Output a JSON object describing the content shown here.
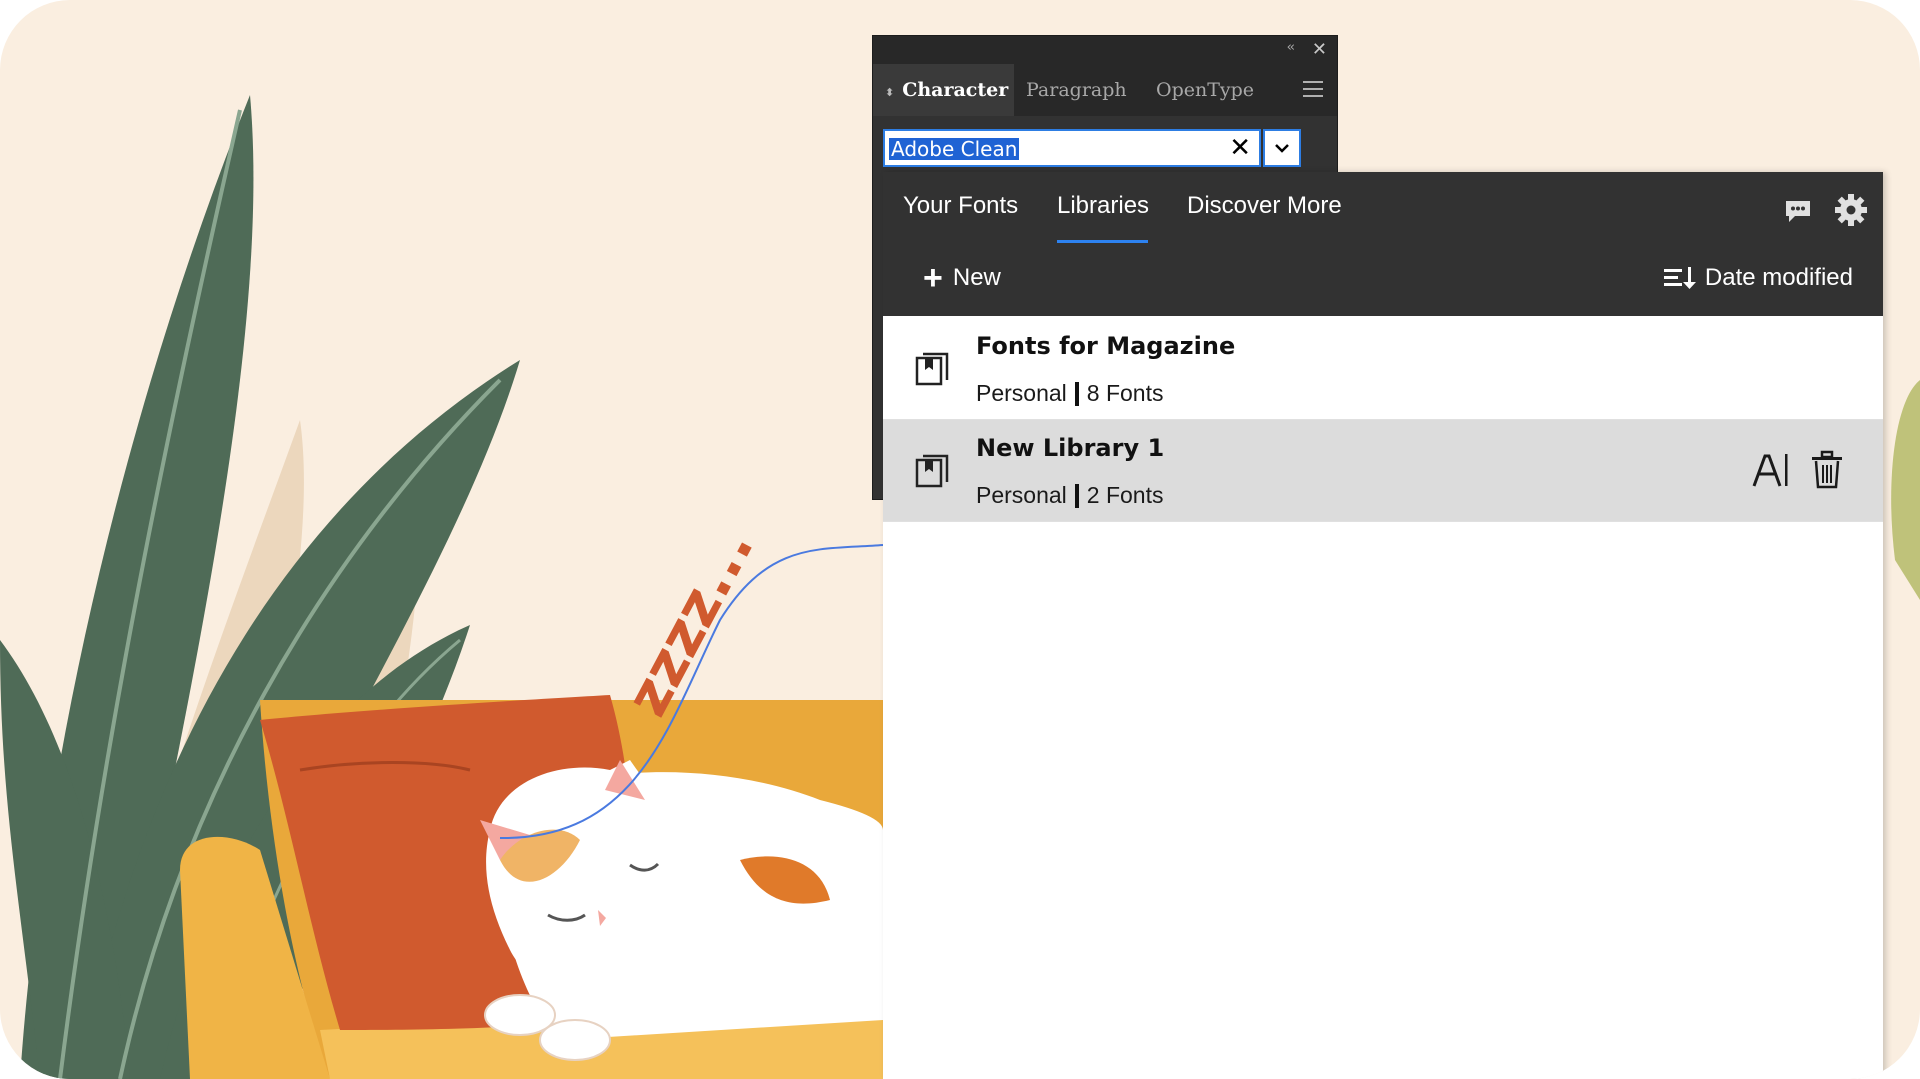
{
  "character_panel": {
    "tabs": [
      {
        "label": "Character",
        "active": true
      },
      {
        "label": "Paragraph",
        "active": false
      },
      {
        "label": "OpenType",
        "active": false
      }
    ],
    "font_family_value": "Adobe Clean"
  },
  "fonts_panel": {
    "tabs": [
      {
        "label": "Your Fonts",
        "active": false
      },
      {
        "label": "Libraries",
        "active": true
      },
      {
        "label": "Discover More",
        "active": false
      }
    ],
    "new_label": "New",
    "sort_label": "Date modified",
    "libraries": [
      {
        "name": "Fonts for Magazine",
        "type": "Personal",
        "count": "8 Fonts",
        "selected": false
      },
      {
        "name": "New Library 1",
        "type": "Personal",
        "count": "2 Fonts",
        "selected": true
      }
    ]
  },
  "illustration": {
    "sleep_text": "zzzz..."
  },
  "colors": {
    "background": "#faeee0",
    "panel_dark": "#323232",
    "accent_blue": "#2d82f0",
    "selected_row": "#dcdcdc",
    "leaf_green": "#4f6b57",
    "sofa_yellow": "#e9a83a",
    "pillow_red": "#d05a2e"
  }
}
